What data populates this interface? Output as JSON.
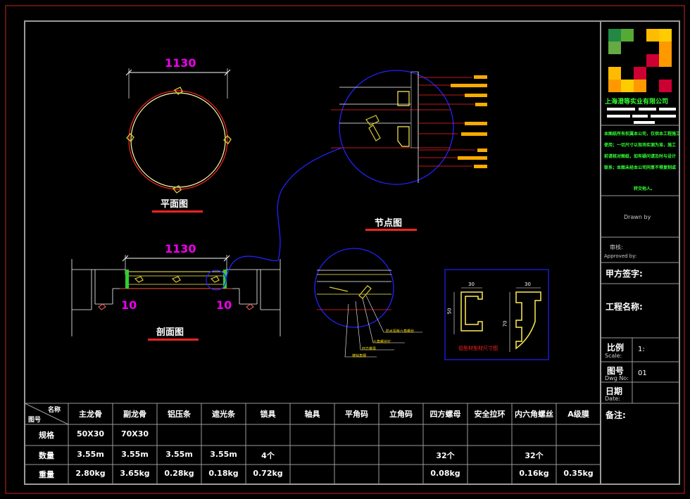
{
  "drawing": {
    "plan_title": "平面图",
    "section_title": "剖面图",
    "node_title": "节点图",
    "plan_dim": "1130",
    "section_dim": "1130",
    "section_left_gap": "10",
    "section_right_gap": "10"
  },
  "profile_detail": {
    "left_width": "30",
    "left_height": "50",
    "right_width": "30",
    "right_height": "70",
    "caption": "铝型材型材尺寸图"
  },
  "small_detail_labels": [
    "防水铝板六角螺丝",
    "六角螺丝钉",
    "四方螺母",
    "镀锌角钢"
  ],
  "title_block": {
    "company": "上海澄等实业有限公司",
    "notes": [
      "本图纸所有权属本公司，仅供本工程施工",
      "使用；一切尺寸以现场实测为准，施工",
      "前请核对图纸，如有疑问请及时与设计",
      "联系；本图未经本公司同意不得复制或",
      "转交他人。"
    ],
    "drawn_by": "Drawn by",
    "approved_cn": "审核:",
    "approved_en": "Approved by:",
    "client_sign": "甲方签字:",
    "project_name": "工程名称:",
    "scale_cn": "比例",
    "scale_en": "Scale:",
    "scale_value": "1:",
    "dwg_cn": "图号",
    "dwg_en": "Dwg No:",
    "dwg_value": "01",
    "date_cn": "日期",
    "date_en": "Date:",
    "remarks": "备注:"
  },
  "colors": {
    "frame_red": "#cc2222",
    "border_gray": "#9a9a9a",
    "yellow": "#ffcc00",
    "magenta": "#ee00ee",
    "blue": "#2222ff",
    "green": "#33ff33",
    "red_line": "#ff2222"
  },
  "table": {
    "corner_top": "名称",
    "corner_bottom": "图号",
    "headers": [
      "主龙骨",
      "副龙骨",
      "铝压条",
      "遮光条",
      "锁具",
      "轴具",
      "平角码",
      "立角码",
      "四方螺母",
      "安全拉环",
      "内六角螺丝",
      "A级膜"
    ],
    "rows": [
      {
        "label": "规格",
        "values": [
          "50X30",
          "70X30",
          "",
          "",
          "",
          "",
          "",
          "",
          "",
          "",
          "",
          ""
        ]
      },
      {
        "label": "数量",
        "values": [
          "3.55m",
          "3.55m",
          "3.55m",
          "3.55m",
          "4个",
          "",
          "",
          "",
          "32个",
          "",
          "32个",
          ""
        ]
      },
      {
        "label": "重量",
        "values": [
          "2.80kg",
          "3.65kg",
          "0.28kg",
          "0.18kg",
          "0.72kg",
          "",
          "",
          "",
          "0.08kg",
          "",
          "0.16kg",
          "0.35kg"
        ]
      }
    ]
  }
}
